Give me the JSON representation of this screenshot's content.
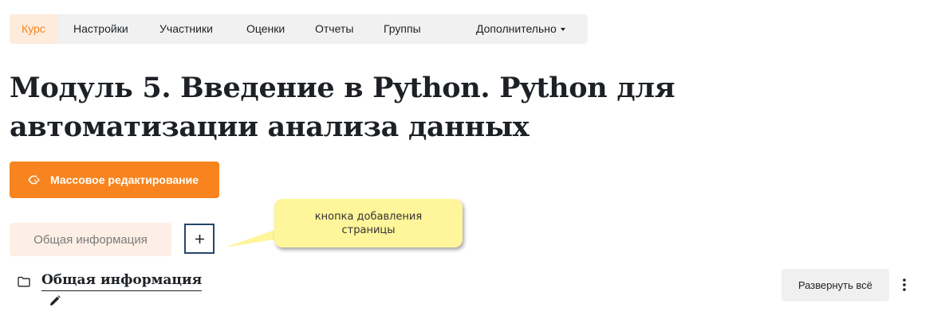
{
  "nav": {
    "items": [
      {
        "label": "Курс",
        "active": true
      },
      {
        "label": "Настройки"
      },
      {
        "label": "Участники"
      },
      {
        "label": "Оценки"
      },
      {
        "label": "Отчеты"
      },
      {
        "label": "Группы"
      }
    ],
    "more_label": "Дополнительно",
    "more_icon": "caret-down-icon"
  },
  "page_title": "Модуль 5. Введение в Python. Python для автоматизации анализа данных",
  "bulk_edit": {
    "label": "Массовое редактирование",
    "icon": "bulk-edit-icon"
  },
  "section_tabs": {
    "items": [
      {
        "label": "Общая информация"
      }
    ],
    "add_label": "+"
  },
  "callout": {
    "text": "кнопка добавления страницы"
  },
  "section": {
    "title": "Общая информация",
    "folder_icon": "folder-icon",
    "edit_icon": "pencil-icon"
  },
  "expand_all_label": "Развернуть всё",
  "more_actions_icon": "kebab-menu-icon",
  "colors": {
    "accent": "#f7841e",
    "accent_light": "#fdebdc",
    "nav_bg": "#f1f1f1",
    "callout_bg": "#fff59a",
    "focus_border": "#27456e"
  }
}
